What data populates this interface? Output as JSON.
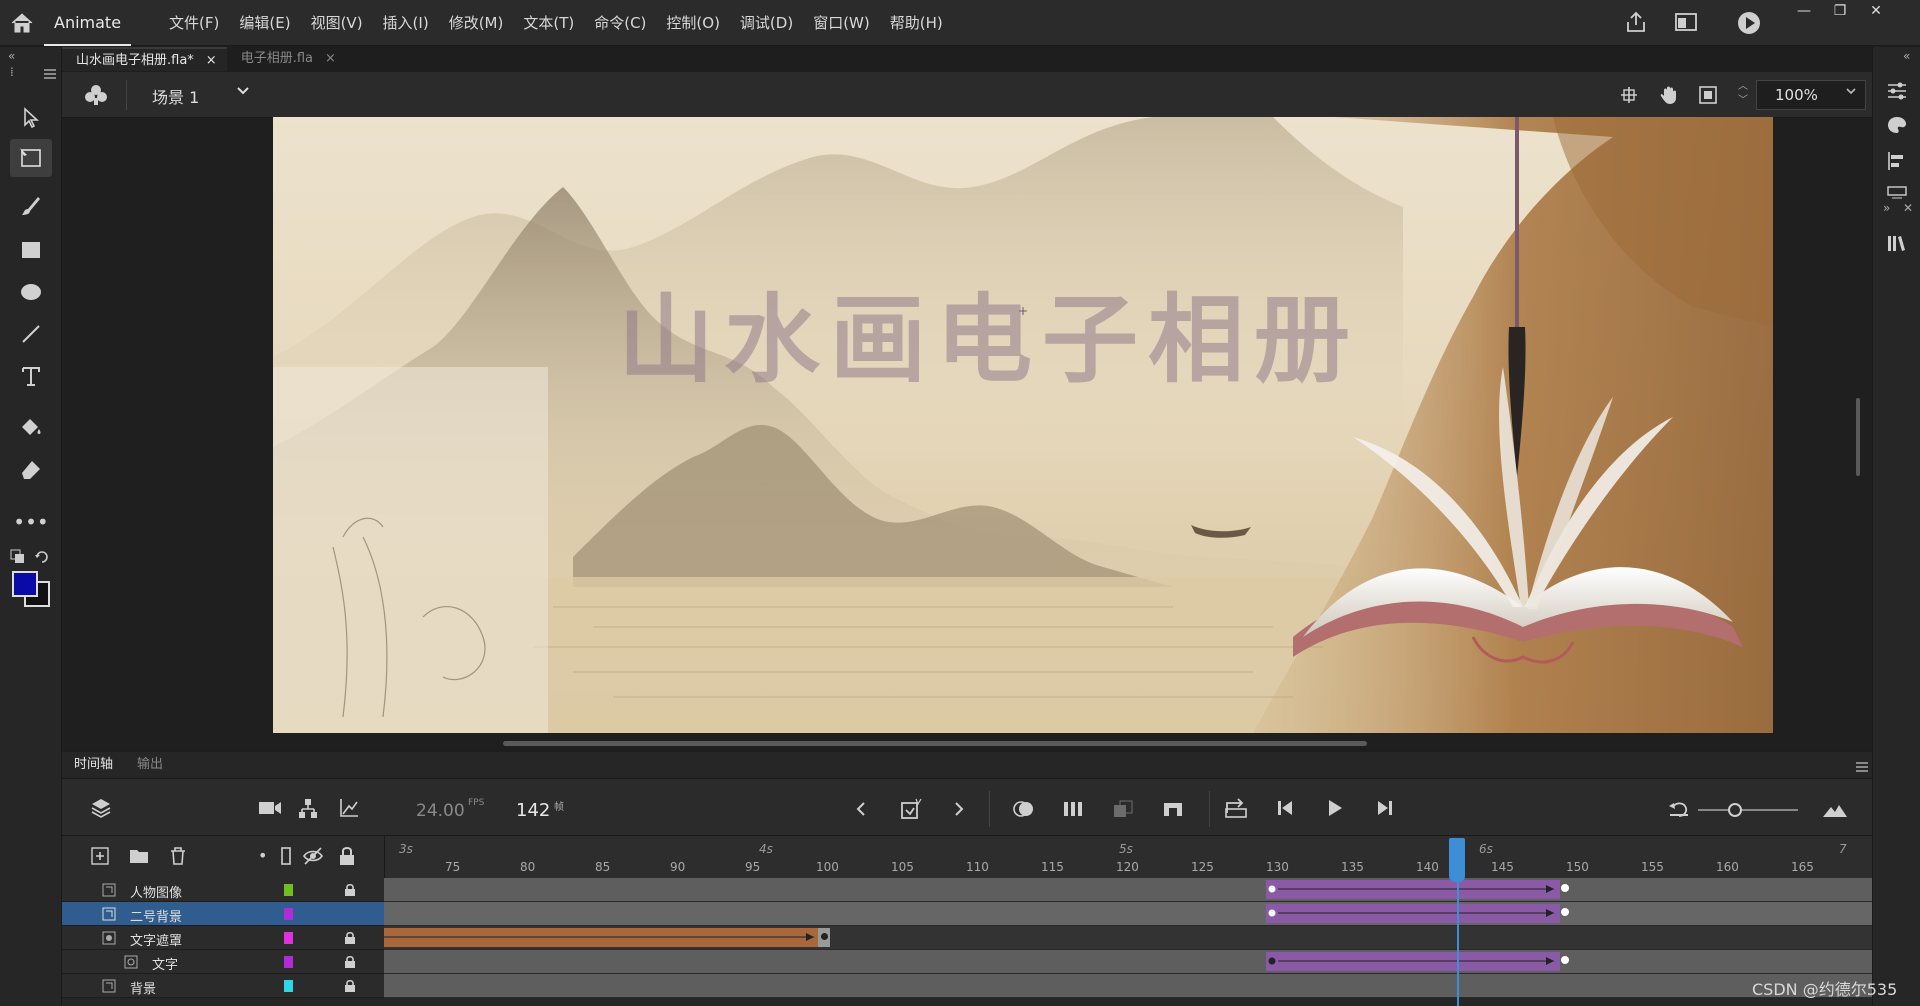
{
  "app": {
    "name": "Animate"
  },
  "menu": [
    "文件(F)",
    "编辑(E)",
    "视图(V)",
    "插入(I)",
    "修改(M)",
    "文本(T)",
    "命令(C)",
    "控制(O)",
    "调试(D)",
    "窗口(W)",
    "帮助(H)"
  ],
  "doc_tabs": [
    {
      "label": "山水画电子相册.fla*",
      "close": "×"
    },
    {
      "label": "电子相册.fla",
      "close": "×"
    }
  ],
  "scene": {
    "label": "场景 1",
    "zoom": "100%"
  },
  "stage": {
    "title_text": "山水画电子相册"
  },
  "colors": {
    "fill": "#0a0aa8",
    "stroke": "#111111",
    "accent": "#3c8ed6",
    "tween_purple": "#8a5aa6",
    "tween_orange": "#a8683c"
  },
  "timeline": {
    "tabs": [
      "时间轴",
      "输出"
    ],
    "fps": "24.00",
    "fps_unit": "FPS",
    "frame": "142",
    "frame_unit": "帧",
    "seconds": [
      "3s",
      "4s",
      "5s",
      "6s",
      "7"
    ],
    "frame_ticks": [
      "75",
      "80",
      "85",
      "90",
      "95",
      "100",
      "105",
      "110",
      "115",
      "120",
      "125",
      "130",
      "135",
      "140",
      "145",
      "150",
      "155",
      "160",
      "165"
    ],
    "layers": [
      {
        "name": "人物图像",
        "color": "#6fbf1f",
        "locked": true,
        "selected": false
      },
      {
        "name": "二号背景",
        "color": "#b22bd6",
        "locked": false,
        "selected": true
      },
      {
        "name": "文字遮罩",
        "color": "#e030e0",
        "locked": true,
        "selected": false
      },
      {
        "name": "文字",
        "color": "#b22bd6",
        "locked": true,
        "selected": false
      },
      {
        "name": "背景",
        "color": "#2fd6e6",
        "locked": true,
        "selected": false
      }
    ]
  },
  "watermark": "CSDN @约德尔535"
}
